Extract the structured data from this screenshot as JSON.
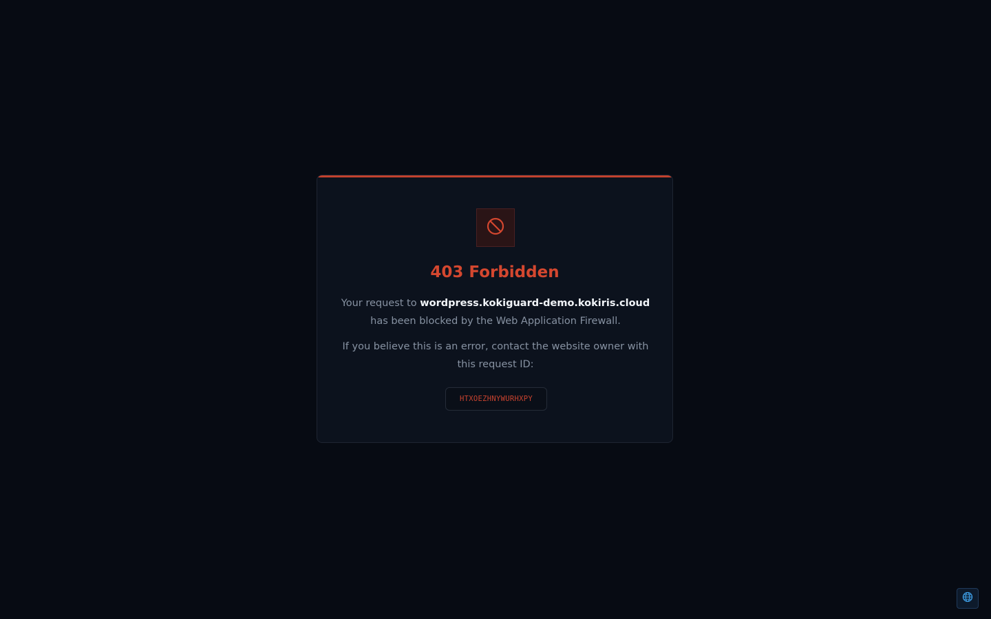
{
  "card": {
    "title": "403 Forbidden",
    "message_prefix": "Your request to ",
    "host": "wordpress.kokiguard-demo.kokiris.cloud",
    "message_suffix": " has been blocked by the Web Application Firewall.",
    "contact_text": "If you believe this is an error, contact the website owner with this request ID:",
    "request_id": "HTXOEZHNYWURHXPY",
    "icon": "block-icon"
  },
  "language_button": {
    "icon": "globe-icon"
  },
  "colors": {
    "background": "#070b13",
    "card": "#0c121d",
    "accent": "#c2412d",
    "title": "#d4472f",
    "body_text": "#8792a2",
    "host_text": "#f1f4f8",
    "globe": "#3fa0e8"
  }
}
